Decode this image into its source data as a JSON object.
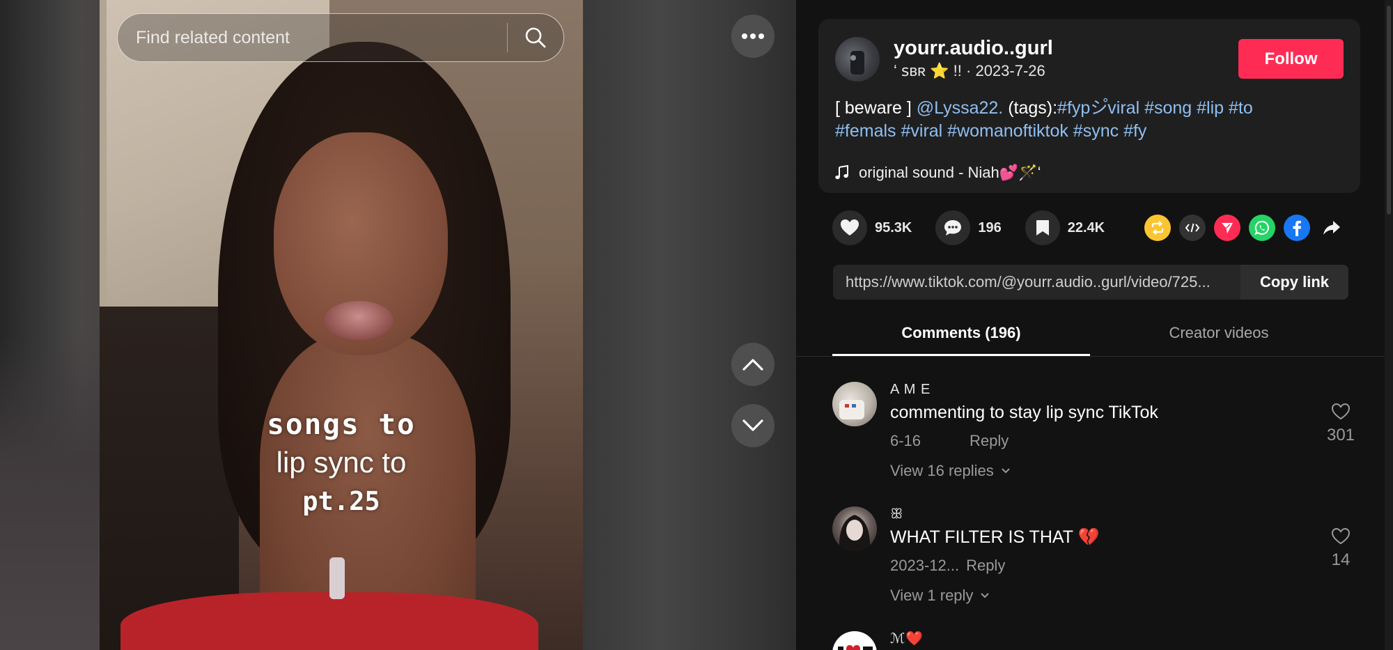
{
  "search": {
    "placeholder": "Find related content"
  },
  "video": {
    "overlay_line1": "songs to",
    "overlay_line2": "lip sync to",
    "overlay_line3": "pt.25"
  },
  "post": {
    "username": "yourr.audio..gurl",
    "subline": "ʻ ꜱʙʀ ⭐ !! · 2023-7-26",
    "follow_label": "Follow",
    "caption_prefix": "[ beware ] ",
    "mention": "@Lyssa22.",
    "caption_mid": " (tags):",
    "hashtags_line1": "#fypシ゚viral #song #lip #to",
    "hashtags_line2": "#femals #viral #womanoftiktok #sync #fy",
    "sound": "original sound - Niah💕🪄ʻ"
  },
  "actions": {
    "likes": "95.3K",
    "comments": "196",
    "saves": "22.4K"
  },
  "share_icons": [
    "repost-icon",
    "embed-icon",
    "send-icon",
    "whatsapp-icon",
    "facebook-icon",
    "share-arrow-icon"
  ],
  "link": {
    "url": "https://www.tiktok.com/@yourr.audio..gurl/video/725...",
    "copy_label": "Copy link"
  },
  "tabs": [
    {
      "label": "Comments (196)",
      "active": true
    },
    {
      "label": "Creator videos",
      "active": false
    }
  ],
  "comments": [
    {
      "name": "A M E",
      "text": "commenting to stay lip sync TikTok",
      "date": "6-16",
      "reply_label": "Reply",
      "likes": "301",
      "view_replies": "View 16 replies"
    },
    {
      "name": "ꕥ",
      "text": "WHAT FILTER IS THAT 💔",
      "date": "2023-12...",
      "reply_label": "Reply",
      "likes": "14",
      "view_replies": "View 1 reply"
    },
    {
      "name": "ℳ❤️"
    }
  ],
  "colors": {
    "accent": "#fe2c55",
    "hashtag": "#8fbff2",
    "panel_bg": "#121212",
    "card_bg": "#1f1f1f"
  }
}
